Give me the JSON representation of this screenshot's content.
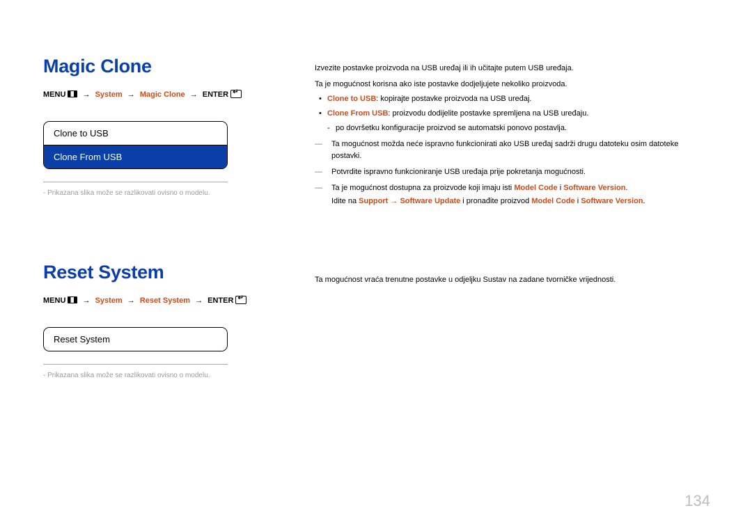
{
  "sections": {
    "magic": {
      "title": "Magic Clone",
      "nav": {
        "menu": "MENU",
        "system": "System",
        "leaf": "Magic Clone",
        "enter": "ENTER"
      },
      "menu_items": {
        "item0": "Clone to USB",
        "item1": "Clone From USB"
      },
      "note": "Prikazana slika može se razlikovati ovisno o modelu.",
      "desc": {
        "p1": "Izvezite postavke proizvoda na USB uređaj ili ih učitajte putem USB uređaja.",
        "p2": "Ta je mogućnost korisna ako iste postavke dodjeljujete nekoliko proizvoda.",
        "cto_label": "Clone to USB",
        "cto_text": ": kopirajte postavke proizvoda na USB uređaj.",
        "cfrom_label": "Clone From USB",
        "cfrom_text": ": proizvodu dodijelite postavke spremljena na USB uređaju.",
        "dash1": "po dovršetku konfiguracije proizvod se automatski ponovo postavlja.",
        "long1": "Ta mogućnost možda neće ispravno funkcionirati ako USB uređaj sadrži drugu datoteku osim datoteke postavki.",
        "long2": "Potvrdite ispravno funkcioniranje USB uređaja prije pokretanja mogućnosti.",
        "long3_pre": "Ta je mogućnost dostupna za proizvode koji imaju isti ",
        "long3_mc": "Model Code",
        "long3_mid": " i ",
        "long3_sv": "Software Version",
        "long3_end": ".",
        "long4_pre": "Idite na ",
        "long4_support": "Support",
        "long4_arrow": " → ",
        "long4_su": "Software Update",
        "long4_mid": " i pronađite proizvod ",
        "long4_mc": "Model Code",
        "long4_mid2": " i ",
        "long4_sv": "Software Version",
        "long4_end": "."
      }
    },
    "reset": {
      "title": "Reset System",
      "nav": {
        "menu": "MENU",
        "system": "System",
        "leaf": "Reset System",
        "enter": "ENTER"
      },
      "menu_items": {
        "item0": "Reset System"
      },
      "note": "Prikazana slika može se razlikovati ovisno o modelu.",
      "desc": {
        "p1": "Ta mogućnost vraća trenutne postavke u odjeljku Sustav na zadane tvorničke vrijednosti."
      }
    }
  },
  "page_number": "134"
}
